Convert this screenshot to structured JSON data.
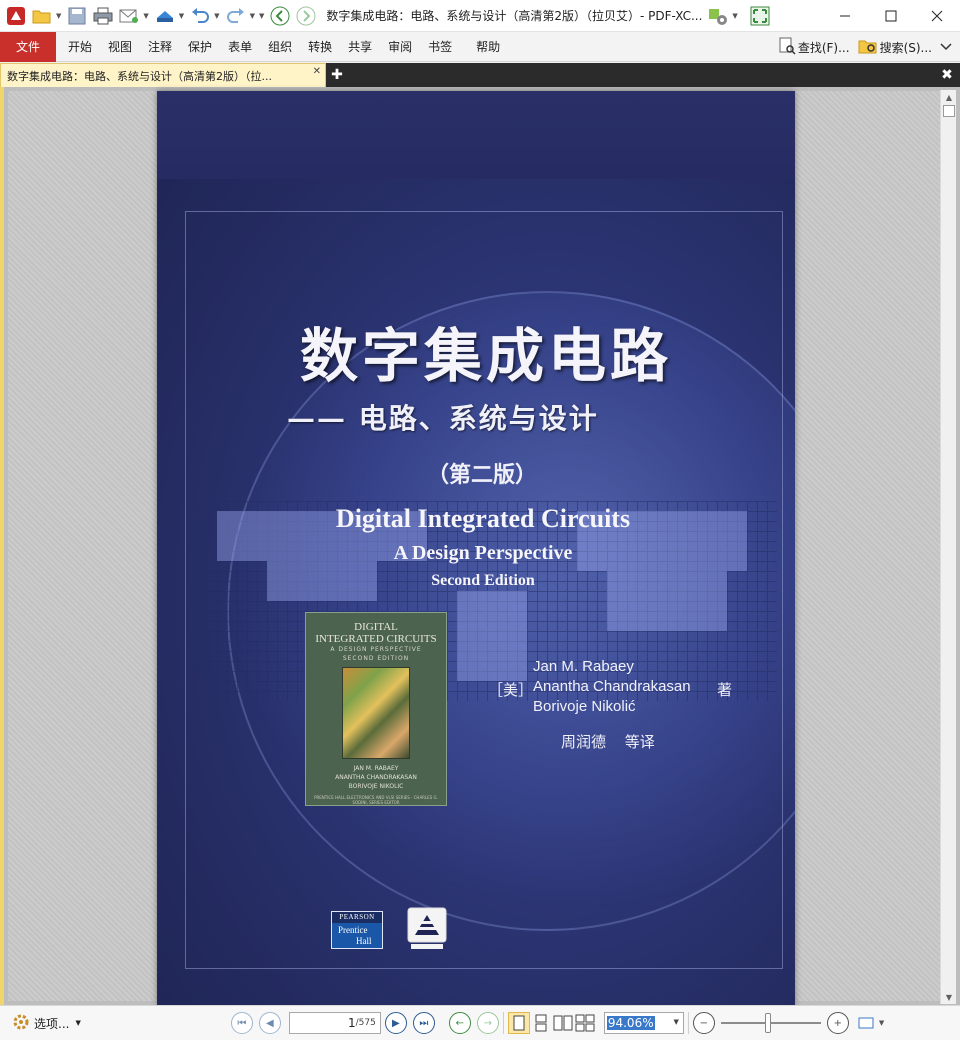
{
  "window": {
    "title": "数字集成电路：电路、系统与设计（高清第2版）（拉贝艾）- PDF-XC..."
  },
  "menubar": {
    "file": "文件",
    "items": [
      "开始",
      "视图",
      "注释",
      "保护",
      "表单",
      "组织",
      "转换",
      "共享",
      "审阅",
      "书签",
      "帮助"
    ],
    "find": "查找(F)...",
    "search": "搜索(S)..."
  },
  "tab": {
    "label": "数字集成电路：电路、系统与设计（高清第2版）（拉..."
  },
  "cover": {
    "cn_title": "数字集成电路",
    "cn_subtitle": "—— 电路、系统与设计",
    "cn_edition": "（第二版）",
    "en_title": "Digital Integrated Circuits",
    "en_subtitle": "A Design Perspective",
    "en_edition": "Second Edition",
    "authors_prefix": "［美］",
    "authors": [
      "Jan M. Rabaey",
      "Anantha Chandrakasan",
      "Borivoje Nikolić"
    ],
    "authors_suffix": "著",
    "translator": "周润德 等译",
    "mini_cover": {
      "line1": "DIGITAL",
      "line2": "INTEGRATED CIRCUITS",
      "line3": "A DESIGN PERSPECTIVE",
      "line4": "SECOND EDITION",
      "author1": "JAN M. RABAEY",
      "author2": "ANANTHA CHANDRAKASAN",
      "author3": "BORIVOJE NIKOLIC",
      "publisher": "PRENTICE HALL ELECTRONICS AND VLSI SERIES · CHARLES G. SODINI, SERIES EDITOR"
    },
    "pearson": {
      "top": "PEARSON",
      "brand1": "Prentice",
      "brand2": "Hall"
    }
  },
  "statusbar": {
    "options": "选项...",
    "current_page": "1",
    "total_pages": "/575",
    "zoom": "94.06%"
  },
  "colors": {
    "file_menu": "#c9302c",
    "tab_active": "#fff4c8",
    "cover_bg": "#2d3676",
    "zoom_highlight": "#3a78c9"
  }
}
